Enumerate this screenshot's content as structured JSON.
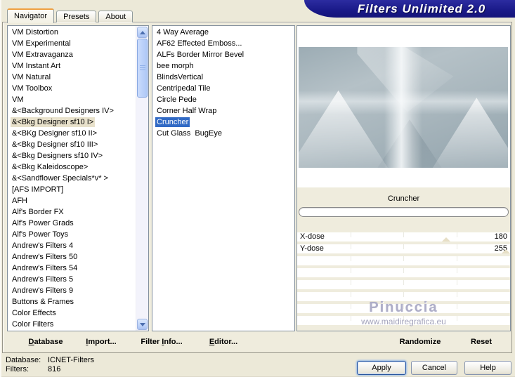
{
  "window": {
    "banner_title": "Filters Unlimited 2.0"
  },
  "tabs": {
    "navigator": "Navigator",
    "presets": "Presets",
    "about": "About"
  },
  "categories": {
    "selected": "&<Bkg Designer sf10 I>",
    "items": [
      "VM Distortion",
      "VM Experimental",
      "VM Extravaganza",
      "VM Instant Art",
      "VM Natural",
      "VM Toolbox",
      "VM",
      "&<Background Designers IV>",
      "&<Bkg Designer sf10 I>",
      "&<BKg Designer sf10 II>",
      "&<Bkg Designer sf10 III>",
      "&<Bkg Designers sf10 IV>",
      "&<Bkg Kaleidoscope>",
      "&<Sandflower Specials*v* >",
      "[AFS IMPORT]",
      "AFH",
      "Alf's Border FX",
      "Alf's Power Grads",
      "Alf's Power Toys",
      "Andrew's Filters 4",
      "Andrew's Filters 50",
      "Andrew's Filters 54",
      "Andrew's Filters 5",
      "Andrew's Filters 9",
      "Buttons & Frames",
      "Color Effects",
      "Color Filters"
    ]
  },
  "filters": {
    "selected": "Cruncher",
    "items": [
      "4 Way Average",
      "AF62 Effected Emboss...",
      "ALFs Border Mirror Bevel",
      "bee morph",
      "BlindsVertical",
      "Centripedal Tile",
      "Circle Pede",
      "Corner Half Wrap",
      "Cruncher",
      "Cut Glass  BugEye"
    ]
  },
  "preview": {
    "name": "Cruncher"
  },
  "params": [
    {
      "label": "X-dose",
      "value": "180",
      "thumb_pct": 70
    },
    {
      "label": "Y-dose",
      "value": "255",
      "thumb_pct": 98
    }
  ],
  "watermark": {
    "line1": "Pinuccia",
    "line2": "www.maidiregrafica.eu"
  },
  "toolbar": {
    "database": {
      "pre": "",
      "key": "D",
      "post": "atabase"
    },
    "import": {
      "pre": "",
      "key": "I",
      "post": "mport..."
    },
    "filter_info": {
      "pre": "Filter ",
      "key": "I",
      "post": "nfo..."
    },
    "editor": {
      "pre": "",
      "key": "E",
      "post": "ditor..."
    },
    "randomize": "Randomize",
    "reset": "Reset"
  },
  "status": {
    "database_label": "Database:",
    "database_value": "ICNET-Filters",
    "filters_label": "Filters:",
    "filters_value": "816"
  },
  "dialog_buttons": {
    "apply": "Apply",
    "cancel": "Cancel",
    "help": "Help"
  },
  "colors": {
    "banner_navy": "#1B1B8A",
    "tab_accent_orange": "#EF9F40",
    "selection_blue": "#316AC5",
    "category_selected_tan": "#E8E1CB",
    "dialog_beige": "#ECE9D8"
  }
}
